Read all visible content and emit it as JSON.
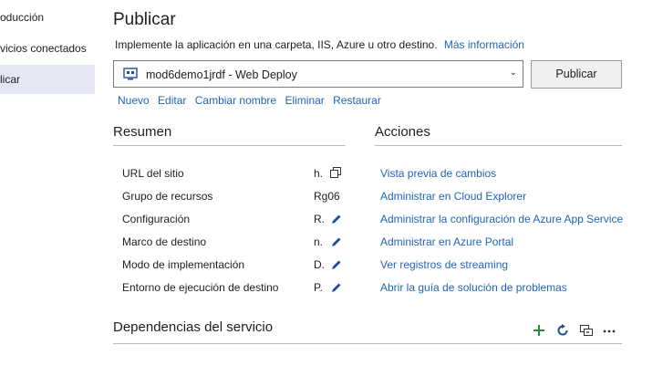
{
  "sidebar": {
    "items": [
      {
        "label": "oducción"
      },
      {
        "label": "vicios conectados"
      },
      {
        "label": "licar"
      }
    ]
  },
  "header": {
    "title": "Publicar",
    "description": "Implemente la aplicación en una carpeta, IIS, Azure u otro destino.",
    "more_info_link": "Más información"
  },
  "profile": {
    "selected": "mod6demo1jrdf - Web Deploy",
    "publish_button": "Publicar",
    "actions": [
      "Nuevo",
      "Editar",
      "Cambiar nombre",
      "Eliminar",
      "Restaurar"
    ]
  },
  "summary": {
    "title": "Resumen",
    "rows": [
      {
        "label": "URL del sitio",
        "value": "h."
      },
      {
        "label": "Grupo de recursos",
        "value": "Rg06"
      },
      {
        "label": "Configuración",
        "value": "R."
      },
      {
        "label": "Marco de destino",
        "value": "n."
      },
      {
        "label": "Modo de implementación",
        "value": "D."
      },
      {
        "label": "Entorno de ejecución de destino",
        "value": "P."
      }
    ]
  },
  "actions": {
    "title": "Acciones",
    "links": [
      "Vista previa de cambios",
      "Administrar en Cloud Explorer",
      "Administrar la configuración de Azure App Service",
      "Administrar en Azure Portal",
      "Ver registros de streaming",
      "Abrir la guía de solución de problemas"
    ]
  },
  "dependencies": {
    "title": "Dependencias del servicio"
  },
  "colors": {
    "accent": "#1f64b8",
    "sidebar_active": "#e6e7f5",
    "pencil": "#1f4e9e",
    "add_green": "#2b8a3e"
  }
}
